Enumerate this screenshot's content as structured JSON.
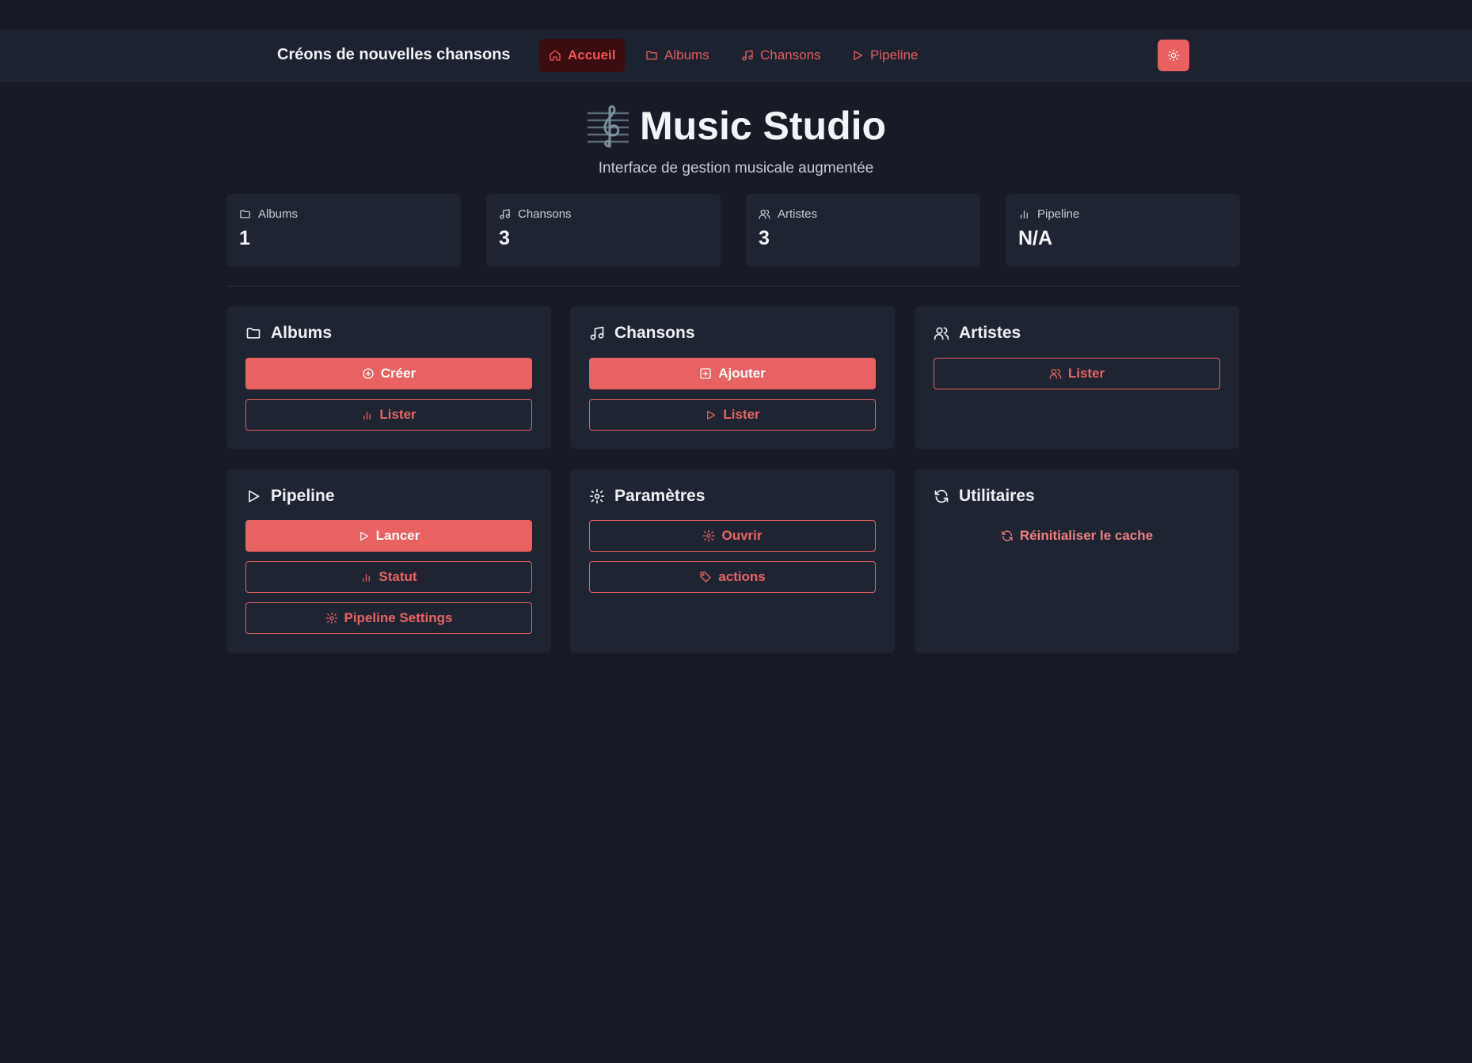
{
  "navbar": {
    "brand": "Créons de nouvelles chansons",
    "items": [
      {
        "label": "Accueil",
        "icon": "home-icon",
        "active": true
      },
      {
        "label": "Albums",
        "icon": "folder-icon"
      },
      {
        "label": "Chansons",
        "icon": "music-note-icon"
      },
      {
        "label": "Pipeline",
        "icon": "play-icon"
      }
    ],
    "theme_toggle_icon": "sun-icon"
  },
  "hero": {
    "icon": "treble-clef-icon",
    "title": "Music Studio",
    "subtitle": "Interface de gestion musicale augmentée"
  },
  "stats": [
    {
      "label": "Albums",
      "value": "1",
      "icon": "folder-icon"
    },
    {
      "label": "Chansons",
      "value": "3",
      "icon": "music-note-icon"
    },
    {
      "label": "Artistes",
      "value": "3",
      "icon": "users-icon"
    },
    {
      "label": "Pipeline",
      "value": "N/A",
      "icon": "bar-chart-icon"
    }
  ],
  "cards": {
    "albums": {
      "title": "Albums",
      "icon": "folder-icon",
      "buttons": [
        {
          "label": "Créer",
          "icon": "plus-circle-icon"
        },
        {
          "label": "Lister",
          "icon": "bar-chart-icon"
        }
      ]
    },
    "chansons": {
      "title": "Chansons",
      "icon": "music-note-icon",
      "buttons": [
        {
          "label": "Ajouter",
          "icon": "plus-square-icon"
        },
        {
          "label": "Lister",
          "icon": "play-icon"
        }
      ]
    },
    "artistes": {
      "title": "Artistes",
      "icon": "users-icon",
      "buttons": [
        {
          "label": "Lister",
          "icon": "users-icon"
        }
      ]
    },
    "pipeline": {
      "title": "Pipeline",
      "icon": "play-icon",
      "buttons": [
        {
          "label": "Lancer",
          "icon": "play-icon"
        },
        {
          "label": "Statut",
          "icon": "bar-chart-icon"
        },
        {
          "label": "Pipeline Settings",
          "icon": "gear-icon"
        }
      ]
    },
    "parametres": {
      "title": "Paramètres",
      "icon": "gear-icon",
      "buttons": [
        {
          "label": "Ouvrir",
          "icon": "gear-icon"
        },
        {
          "label": "actions",
          "icon": "tag-icon"
        }
      ]
    },
    "utilitaires": {
      "title": "Utilitaires",
      "icon": "refresh-icon",
      "buttons": [
        {
          "label": "Réinitialiser le cache",
          "icon": "refresh-icon"
        }
      ]
    }
  },
  "colors": {
    "accent": "#e86262",
    "background": "#181b25",
    "card": "#1e2432",
    "navbar": "#1c2230"
  }
}
